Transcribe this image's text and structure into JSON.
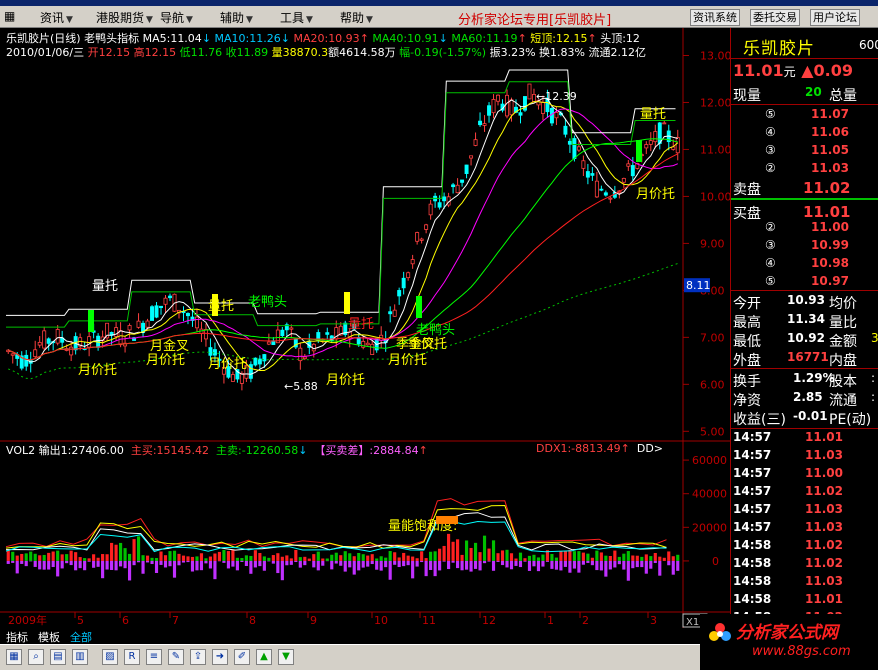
{
  "menu": {
    "items": [
      "资讯",
      "港股期货",
      "导航",
      "辅助",
      "工具",
      "帮助"
    ],
    "forum_label": "分析家论坛专用",
    "forum_bracket": "[乐凯胶片]",
    "buttons": [
      "资讯系统",
      "委托交易",
      "用户论坛"
    ]
  },
  "header": {
    "name": "乐凯胶片(日线)",
    "indicator": "老鸭头指标",
    "ma5": "MA5:11.04",
    "ma10": "MA10:11.26",
    "ma20": "MA20:10.93",
    "ma40": "MA40:10.91",
    "ma60": "MA60:11.19",
    "short_top": "短顶:12.15",
    "head_top": "头顶:12",
    "date": "2010/01/06/三",
    "open": "开12.15",
    "high": "高12.15",
    "low": "低11.76",
    "close": "收11.89",
    "volume": "量38870.3",
    "amount": "额4614.58万",
    "change": "幅-0.19(-1.57%)",
    "amplitude": "振3.23%",
    "turnover": "换1.83%",
    "float": "流通2.12亿"
  },
  "volume_panel": {
    "vol": "VOL2",
    "out": "输出1:27406.00",
    "zhumai": "主买:15145.42",
    "zhumai2": "主卖:-12260.58",
    "maimaicha": "【买卖差】:2884.84",
    "ddx": "DDX1:-8813.49",
    "dd": "DD>"
  },
  "chart_labels": {
    "max_price": "12.39",
    "min_price": "5.88",
    "price_marker": "8.11",
    "zoom": "X10",
    "year": "2009年",
    "annotations": [
      "量托",
      "月价托",
      "月金叉",
      "月价托",
      "量托",
      "月价托",
      "老鸭头",
      "月价托",
      "量托",
      "老鸭头",
      "季金叉",
      "月价托",
      "季价托",
      "量托",
      "月价托",
      "量能饱和度:"
    ]
  },
  "chart_data": [
    {
      "type": "line",
      "yticks": [
        "13.00",
        "12.00",
        "11.00",
        "10.00",
        "9.00",
        "8.00",
        "7.00",
        "6.00",
        "5.00"
      ],
      "ylim": [
        4.9,
        13.5
      ],
      "xticks": [
        "5",
        "6",
        "7",
        "8",
        "9",
        "10",
        "11",
        "12",
        "1",
        "2",
        "3"
      ],
      "series": [
        {
          "values": [
            6.7,
            6.5,
            6.9,
            7.0,
            6.8,
            6.9,
            7.1,
            7.0,
            7.2,
            7.6,
            7.8,
            7.5,
            7.0,
            6.5,
            6.1,
            6.3,
            6.9,
            7.2,
            6.6,
            6.9,
            7.0,
            7.2,
            6.8,
            7.0,
            8.0,
            9.0,
            9.8,
            10.0,
            10.5,
            11.5,
            12.1,
            11.8,
            12.2,
            11.9,
            11.5,
            10.8,
            10.2,
            10.1,
            10.5,
            10.9,
            11.4,
            11.1
          ]
        }
      ]
    },
    {
      "type": "bar",
      "yticks": [
        "60000",
        "40000",
        "20000",
        "0"
      ],
      "ylim": [
        -28000,
        66000
      ]
    }
  ],
  "right_panel": {
    "stock_name": "乐凯胶片",
    "stock_code": "600",
    "price": "11.01",
    "price_unit": "元",
    "change": "▲0.09",
    "xianliang_label": "现量",
    "xianliang": "20",
    "zongliang_label": "总量",
    "asks": [
      {
        "lvl": "⑤",
        "price": "11.07"
      },
      {
        "lvl": "④",
        "price": "11.06"
      },
      {
        "lvl": "③",
        "price": "11.05"
      },
      {
        "lvl": "②",
        "price": "11.03"
      }
    ],
    "ask1_label": "卖盘",
    "ask1": "11.02",
    "bid1_label": "买盘",
    "bid1": "11.01",
    "bids": [
      {
        "lvl": "②",
        "price": "11.00"
      },
      {
        "lvl": "③",
        "price": "10.99"
      },
      {
        "lvl": "④",
        "price": "10.98"
      },
      {
        "lvl": "⑤",
        "price": "10.97"
      }
    ],
    "stats": [
      {
        "l": "今开",
        "v": "10.93",
        "l2": "均价",
        "v2": ""
      },
      {
        "l": "最高",
        "v": "11.34",
        "l2": "量比",
        "v2": ""
      },
      {
        "l": "最低",
        "v": "10.92",
        "l2": "金额",
        "v2": "3"
      },
      {
        "l": "外盘",
        "v": "16771",
        "l2": "内盘",
        "v2": ""
      }
    ],
    "stats2": [
      {
        "l": "换手",
        "v": "1.29%",
        "l2": "股本",
        "v2": ":"
      },
      {
        "l": "净资",
        "v": "2.85",
        "l2": "流通",
        "v2": ":"
      },
      {
        "l": "收益(三)",
        "v": "-0.01",
        "l2": "PE(动)",
        "v2": ""
      }
    ],
    "ticks": [
      {
        "t": "14:57",
        "p": "11.01"
      },
      {
        "t": "14:57",
        "p": "11.03"
      },
      {
        "t": "14:57",
        "p": "11.00"
      },
      {
        "t": "14:57",
        "p": "11.02"
      },
      {
        "t": "14:57",
        "p": "11.03"
      },
      {
        "t": "14:57",
        "p": "11.03"
      },
      {
        "t": "14:58",
        "p": "11.02"
      },
      {
        "t": "14:58",
        "p": "11.02"
      },
      {
        "t": "14:58",
        "p": "11.03"
      },
      {
        "t": "14:58",
        "p": "11.01"
      },
      {
        "t": "14:58",
        "p": "11.02"
      }
    ]
  },
  "tabs": [
    "指标",
    "模板",
    "全部"
  ],
  "brand": {
    "title": "分析家公式网",
    "url": "www.88gs.com"
  },
  "colors": {
    "up": "#ff4040",
    "down": "#00ffff",
    "bg": "#000000",
    "axis": "#a00000"
  }
}
